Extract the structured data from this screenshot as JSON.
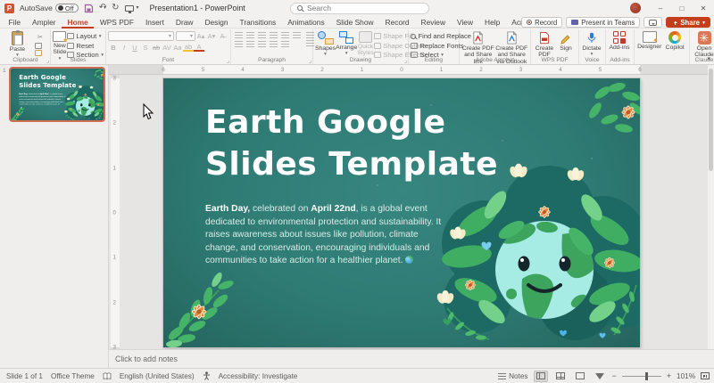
{
  "titlebar": {
    "autosave_label": "AutoSave",
    "autosave_state": "Off",
    "title": "Presentation1 - PowerPoint",
    "search_placeholder": "Search"
  },
  "menu_tabs": [
    "File",
    "Ampler",
    "Home",
    "WPS PDF",
    "Insert",
    "Draw",
    "Design",
    "Transitions",
    "Animations",
    "Slide Show",
    "Record",
    "Review",
    "View",
    "Help",
    "Acrobat"
  ],
  "active_tab": "Home",
  "top_actions": {
    "record": "Record",
    "present": "Present in Teams",
    "share": "Share"
  },
  "icons": {
    "chevron": "▾",
    "launcher": "⌟",
    "undo": "↶",
    "redo": "↻",
    "scissors": "✂",
    "minimize": "–",
    "maximize": "□",
    "close": "✕",
    "app_letter": "P",
    "minus": "−",
    "plus": "+",
    "asterisk": "✳"
  },
  "ribbon": {
    "clipboard": {
      "paste": "Paste",
      "label": "Clipboard"
    },
    "slides": {
      "new_slide": "New Slide",
      "layout": "Layout",
      "reset": "Reset",
      "section": "Section",
      "label": "Slides"
    },
    "font": {
      "label": "Font",
      "row1_icons": [
        {
          "name": "increase-font-size-button",
          "glyph": "A▴"
        },
        {
          "name": "decrease-font-size-button",
          "glyph": "A▾"
        },
        {
          "name": "clear-formatting-button",
          "glyph": "A̶"
        }
      ],
      "row2_icons": [
        {
          "name": "bold-button",
          "glyph": "B",
          "cls": "gb"
        },
        {
          "name": "italic-button",
          "glyph": "I",
          "cls": "gi"
        },
        {
          "name": "underline-button",
          "glyph": "U",
          "cls": "gu"
        },
        {
          "name": "shadow-button",
          "glyph": "S"
        },
        {
          "name": "strikethrough-button",
          "glyph": "ab",
          "cls": "gst"
        },
        {
          "name": "character-spacing-button",
          "glyph": "AV"
        },
        {
          "name": "change-case-button",
          "glyph": "Aa"
        },
        {
          "name": "highlight-color-button",
          "glyph": "ab",
          "cls": "hl"
        },
        {
          "name": "font-color-button",
          "glyph": "A",
          "cls": "fc"
        }
      ]
    },
    "paragraph": {
      "label": "Paragraph",
      "row1_icons": [
        {
          "name": "bullets-button"
        },
        {
          "name": "numbering-button"
        },
        {
          "name": "indent-decrease-button"
        },
        {
          "name": "indent-increase-button"
        },
        {
          "name": "line-spacing-button"
        },
        {
          "name": "text-direction-button"
        }
      ],
      "row2_icons": [
        {
          "name": "align-left-button"
        },
        {
          "name": "align-center-button"
        },
        {
          "name": "align-right-button"
        },
        {
          "name": "justify-button"
        },
        {
          "name": "columns-button"
        }
      ],
      "side_icons": [
        {
          "name": "align-text-button"
        },
        {
          "name": "convert-to-smartart-button"
        }
      ]
    },
    "drawing": {
      "label": "Drawing",
      "shapes": "Shapes",
      "arrange": "Arrange",
      "quick_styles": "Quick Styles",
      "shape_fill": "Shape Fill",
      "shape_outline": "Shape Outline",
      "shape_effects": "Shape Effects"
    },
    "editing": {
      "label": "Editing",
      "find": "Find and Replace",
      "replace_fonts": "Replace Fonts",
      "select": "Select"
    },
    "acrobat": {
      "label": "Adobe Acrobat",
      "btn1": "Create PDF and Share link",
      "btn2": "Create PDF and Share via Outlook"
    },
    "wps": {
      "label": "WPS PDF",
      "create_pdf": "Create PDF",
      "sign": "Sign"
    },
    "voice": {
      "label": "Voice",
      "dictate": "Dictate"
    },
    "addins": {
      "label": "Add-ins",
      "addins": "Add-ins"
    },
    "design_tools": {
      "designer": "Designer",
      "copilot": "Copilot"
    },
    "claude": {
      "label": "Claude",
      "open_claude": "Open Claude"
    }
  },
  "ruler": {
    "h_numbers": [
      "6",
      "5",
      "4",
      "3",
      "2",
      "1",
      "0",
      "1",
      "2",
      "3",
      "4",
      "5",
      "6"
    ],
    "v_numbers": [
      "3",
      "2",
      "1",
      "0",
      "1",
      "2",
      "3"
    ]
  },
  "thumbnail_panel": {
    "slide_number": "1"
  },
  "slide": {
    "title_line1": "Earth Google",
    "title_line2": "Slides Template",
    "body_segments": [
      {
        "text": "Earth Day,",
        "bold": true
      },
      {
        "text": " celebrated on ",
        "bold": false
      },
      {
        "text": "April 22nd",
        "bold": true
      },
      {
        "text": ", is a global event dedicated to environmental protection and sustainability. It raises awareness about issues like pollution, climate change, and conservation, encouraging individuals and communities to take action for a healthier planet. ",
        "bold": false
      },
      {
        "text": "",
        "emoji": true
      }
    ]
  },
  "notes": {
    "placeholder": "Click to add notes"
  },
  "statusbar": {
    "slide_info": "Slide 1 of 1",
    "theme": "Office Theme",
    "language": "English (United States)",
    "accessibility": "Accessibility: Investigate",
    "notes_label": "Notes",
    "zoom_level": "101%"
  },
  "colors": {
    "accent": "#c43e1c",
    "slide_teal": "#2e7b74",
    "claude_orange": "#d97757"
  }
}
